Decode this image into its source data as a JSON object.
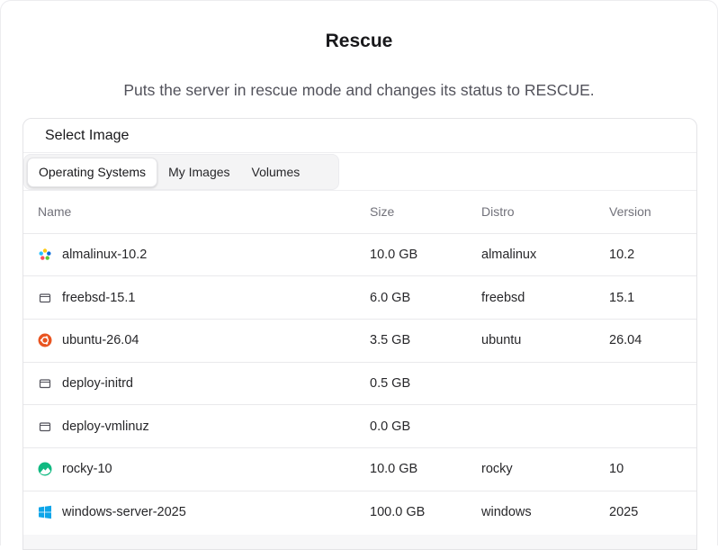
{
  "dialog": {
    "title": "Rescue",
    "description": "Puts the server in rescue mode and changes its status to RESCUE."
  },
  "card": {
    "heading": "Select Image",
    "tabs": [
      {
        "label": "Operating Systems",
        "active": true
      },
      {
        "label": "My Images",
        "active": false
      },
      {
        "label": "Volumes",
        "active": false
      }
    ]
  },
  "table": {
    "columns": [
      "Name",
      "Size",
      "Distro",
      "Version"
    ],
    "rows": [
      {
        "icon": "almalinux-logo-icon",
        "name": "almalinux-10.2",
        "size": "10.0 GB",
        "distro": "almalinux",
        "version": "10.2"
      },
      {
        "icon": "disk-image-icon",
        "name": "freebsd-15.1",
        "size": "6.0 GB",
        "distro": "freebsd",
        "version": "15.1"
      },
      {
        "icon": "ubuntu-logo-icon",
        "name": "ubuntu-26.04",
        "size": "3.5 GB",
        "distro": "ubuntu",
        "version": "26.04"
      },
      {
        "icon": "disk-image-icon",
        "name": "deploy-initrd",
        "size": "0.5 GB",
        "distro": "",
        "version": ""
      },
      {
        "icon": "disk-image-icon",
        "name": "deploy-vmlinuz",
        "size": "0.0 GB",
        "distro": "",
        "version": ""
      },
      {
        "icon": "rocky-logo-icon",
        "name": "rocky-10",
        "size": "10.0 GB",
        "distro": "rocky",
        "version": "10"
      },
      {
        "icon": "windows-logo-icon",
        "name": "windows-server-2025",
        "size": "100.0 GB",
        "distro": "windows",
        "version": "2025"
      }
    ]
  },
  "colors": {
    "ubuntu": "#e95420",
    "rocky": "#10b981",
    "windows": "#0ea5e9"
  }
}
